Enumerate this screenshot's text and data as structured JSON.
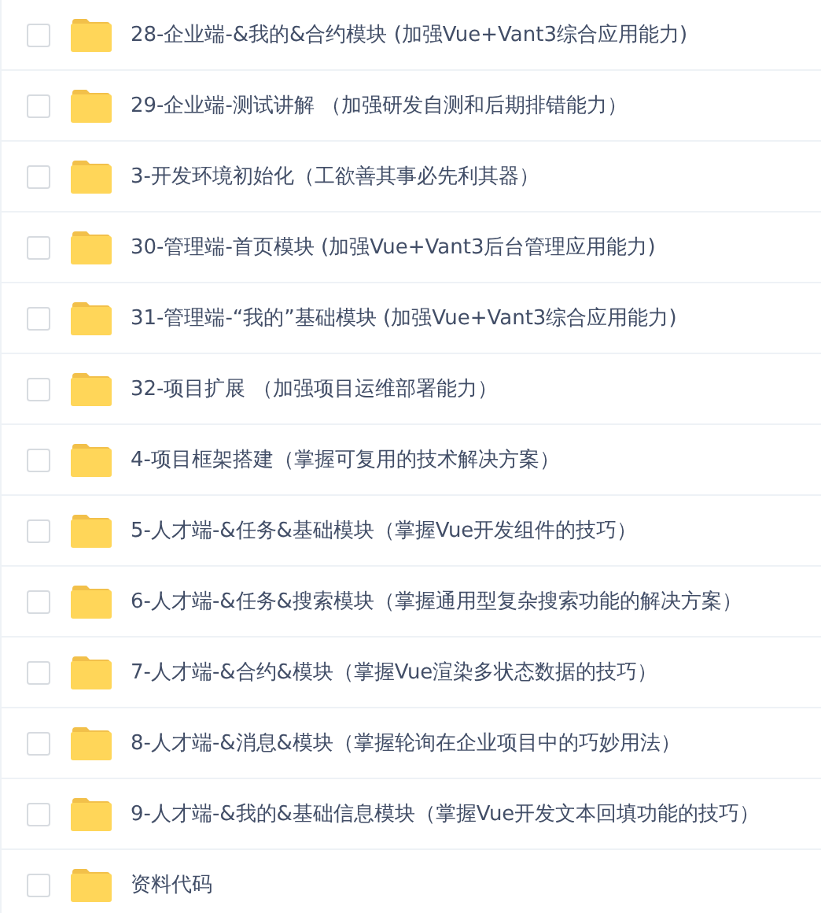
{
  "files": [
    {
      "name": "28-企业端-&我的&合约模块 (加强Vue+Vant3综合应用能力)",
      "checked": false
    },
    {
      "name": "29-企业端-测试讲解 （加强研发自测和后期排错能力）",
      "checked": false
    },
    {
      "name": "3-开发环境初始化（工欲善其事必先利其器）",
      "checked": false
    },
    {
      "name": "30-管理端-首页模块 (加强Vue+Vant3后台管理应用能力)",
      "checked": false
    },
    {
      "name": "31-管理端-“我的”基础模块 (加强Vue+Vant3综合应用能力)",
      "checked": false
    },
    {
      "name": "32-项目扩展 （加强项目运维部署能力）",
      "checked": false
    },
    {
      "name": "4-项目框架搭建（掌握可复用的技术解决方案）",
      "checked": false
    },
    {
      "name": "5-人才端-&任务&基础模块（掌握Vue开发组件的技巧）",
      "checked": false
    },
    {
      "name": "6-人才端-&任务&搜索模块（掌握通用型复杂搜索功能的解决方案）",
      "checked": false
    },
    {
      "name": "7-人才端-&合约&模块（掌握Vue渲染多状态数据的技巧）",
      "checked": false
    },
    {
      "name": "8-人才端-&消息&模块（掌握轮询在企业项目中的巧妙用法）",
      "checked": false
    },
    {
      "name": "9-人才端-&我的&基础信息模块（掌握Vue开发文本回填功能的技巧）",
      "checked": false
    },
    {
      "name": "资料代码",
      "checked": false
    }
  ]
}
